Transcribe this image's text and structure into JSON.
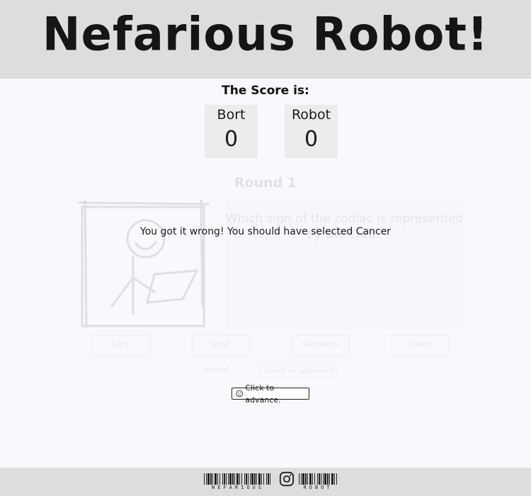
{
  "header": {
    "title": "Nefarious Robot!"
  },
  "score": {
    "heading": "The Score is:",
    "player": {
      "name": "Bort",
      "value": "0"
    },
    "robot": {
      "name": "Robot",
      "value": "0"
    }
  },
  "round": {
    "label": "Round 1",
    "question": "Which sign of the zodiac is represented by the crab?",
    "answers": [
      "Libra",
      "Virgo",
      "Sagittarius",
      "Cancer"
    ],
    "hint_label": "Reveal",
    "submit_label": "Submit for judgement"
  },
  "result": {
    "message": "You got it wrong! You should have selected Cancer",
    "advance_label": "Click to advance."
  },
  "footer": {
    "left_text": "NEFARIOUS",
    "right_text": "ROBOT",
    "social_icon": "instagram-icon"
  }
}
